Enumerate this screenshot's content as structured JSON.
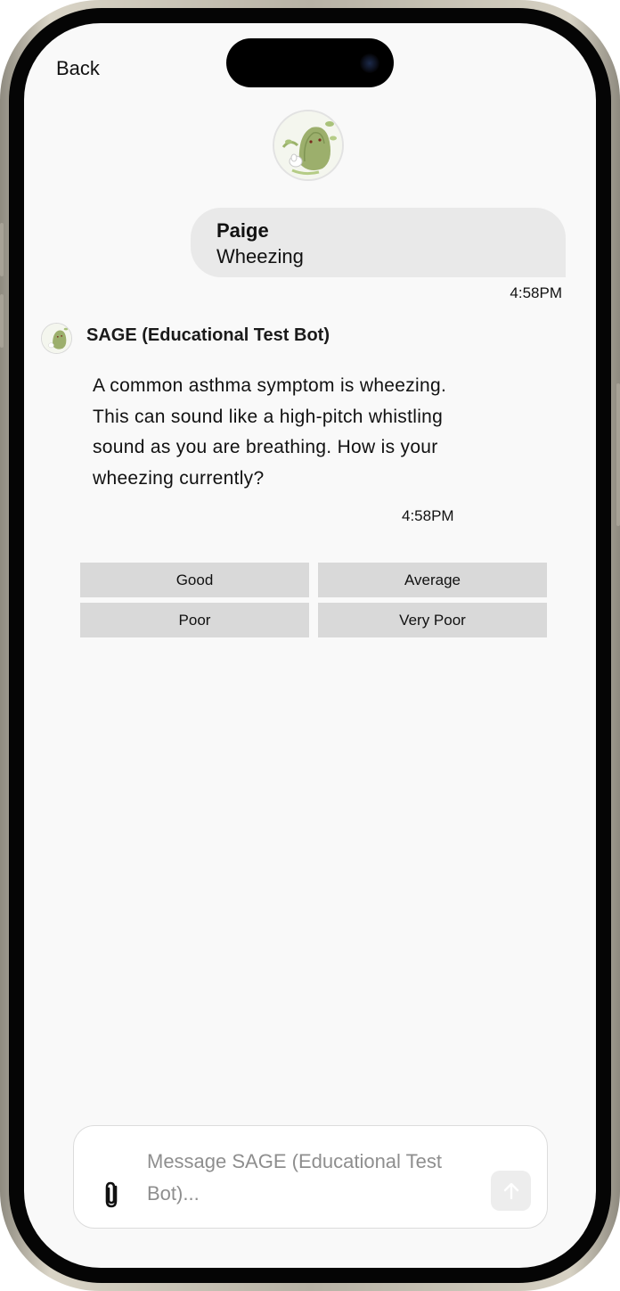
{
  "nav": {
    "back_label": "Back"
  },
  "bot": {
    "name": "SAGE (Educational Test Bot)",
    "avatar_icon": "sage-avatar-icon"
  },
  "messages": [
    {
      "sender": "Paige",
      "text": "Wheezing",
      "time": "4:58PM"
    },
    {
      "sender": "SAGE (Educational Test Bot)",
      "text": "A common asthma symptom is wheezing. This can sound like a high-pitch whistling sound as you are breathing. How is your wheezing currently?",
      "time": "4:58PM"
    }
  ],
  "options": [
    "Good",
    "Average",
    "Poor",
    "Very Poor"
  ],
  "composer": {
    "placeholder": "Message SAGE (Educational Test Bot)...",
    "attach_icon": "paperclip-icon",
    "send_icon": "arrow-up-icon"
  },
  "colors": {
    "screen_bg": "#f9f9f9",
    "user_bubble": "#e9e9e9",
    "option_bg": "#d9d9d9",
    "placeholder": "#8e8e8e"
  }
}
